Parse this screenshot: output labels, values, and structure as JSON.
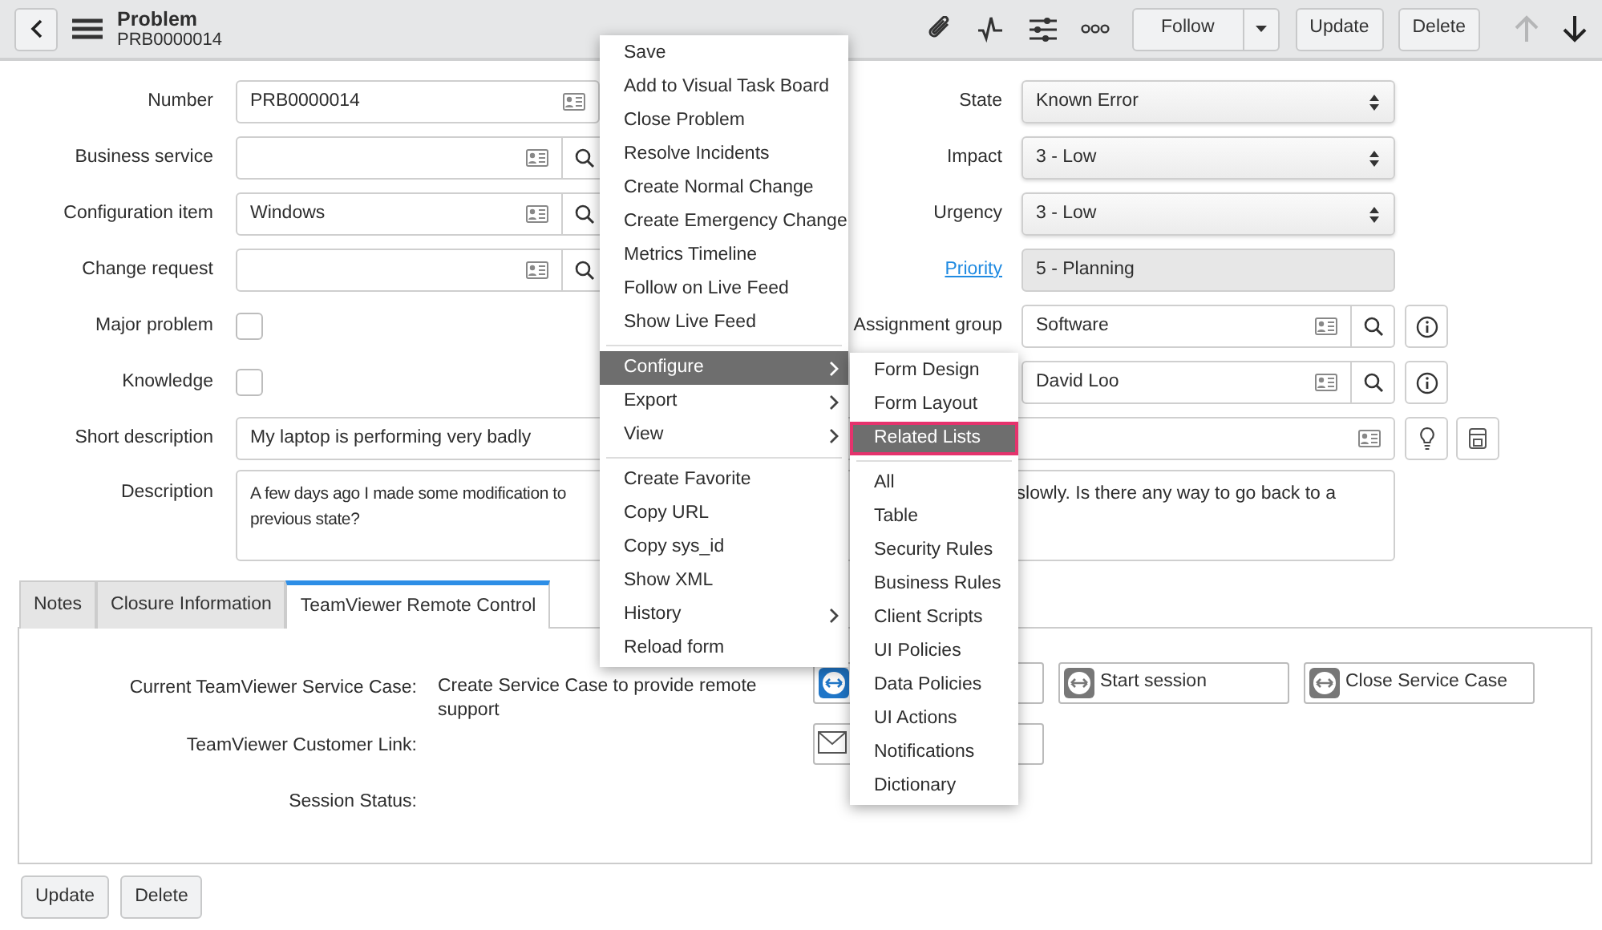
{
  "header": {
    "title": "Problem",
    "subtitle": "PRB0000014",
    "follow": "Follow",
    "buttons": [
      "Update",
      "Delete"
    ],
    "nav": [
      {
        "kind": "up",
        "disabled": true
      },
      {
        "kind": "down",
        "disabled": false
      }
    ]
  },
  "form": {
    "left": [
      {
        "label": "Number",
        "kind": "text-ref",
        "value": "PRB0000014"
      },
      {
        "label": "Business service",
        "kind": "reference"
      },
      {
        "label": "Configuration item",
        "kind": "reference",
        "value": "Windows"
      },
      {
        "label": "Change request",
        "kind": "reference"
      },
      {
        "label": "Major problem",
        "kind": "checkbox",
        "checked": false
      },
      {
        "label": "Knowledge",
        "kind": "checkbox",
        "checked": false
      }
    ],
    "right": [
      {
        "label": "State",
        "kind": "select",
        "value": "Known Error"
      },
      {
        "label": "Impact",
        "kind": "select",
        "value": "3 - Low"
      },
      {
        "label": "Urgency",
        "kind": "select",
        "value": "3 - Low"
      },
      {
        "label": "Priority",
        "kind": "readonly",
        "link": true,
        "value": "5 - Planning"
      },
      {
        "label": "Assignment group",
        "kind": "reference-info",
        "value": "Software"
      },
      {
        "kind": "reference-info",
        "value": "David Loo"
      }
    ],
    "short_description": {
      "label": "Short description",
      "value": "My laptop is performing very badly"
    },
    "description": {
      "label": "Description",
      "visible_left": "A few days ago I made some modification to",
      "visible_right": "slowly. Is there any way to go back to a",
      "line_2": "previous state?"
    }
  },
  "tabs": [
    {
      "label": "Notes",
      "selected": false
    },
    {
      "label": "Closure Information",
      "selected": false
    },
    {
      "label": "TeamViewer Remote Control",
      "selected": true
    }
  ],
  "teamviewer": {
    "rows": [
      {
        "label": "Current TeamViewer Service Case:",
        "value": "Create Service Case to provide remote support"
      },
      {
        "label": "TeamViewer Customer Link:"
      },
      {
        "label": "Session Status:"
      }
    ],
    "buttons": [
      {
        "kind": "teamviewer"
      },
      {
        "kind": "teamviewer",
        "label": "Start session"
      },
      {
        "kind": "teamviewer",
        "label": "Close Service Case"
      },
      {
        "kind": "mail"
      }
    ]
  },
  "footer_buttons": [
    "Update",
    "Delete"
  ],
  "context_menu": {
    "groups": [
      [
        {
          "label": "Save",
          "submenu": false,
          "selected": false
        },
        {
          "label": "Add to Visual Task Board",
          "submenu": false,
          "selected": false
        },
        {
          "label": "Close Problem",
          "submenu": false,
          "selected": false
        },
        {
          "label": "Resolve Incidents",
          "submenu": false,
          "selected": false
        },
        {
          "label": "Create Normal Change",
          "submenu": false,
          "selected": false
        },
        {
          "label": "Create Emergency Change",
          "submenu": false,
          "selected": false
        },
        {
          "label": "Metrics Timeline",
          "submenu": false,
          "selected": false
        },
        {
          "label": "Follow on Live Feed",
          "submenu": false,
          "selected": false
        },
        {
          "label": "Show Live Feed",
          "submenu": false,
          "selected": false
        }
      ],
      [
        {
          "label": "Configure",
          "submenu": true,
          "selected": true
        },
        {
          "label": "Export",
          "submenu": true,
          "selected": false
        },
        {
          "label": "View",
          "submenu": true,
          "selected": false
        }
      ],
      [
        {
          "label": "Create Favorite",
          "submenu": false,
          "selected": false
        },
        {
          "label": "Copy URL",
          "submenu": false,
          "selected": false
        },
        {
          "label": "Copy sys_id",
          "submenu": false,
          "selected": false
        },
        {
          "label": "Show XML",
          "submenu": false,
          "selected": false
        },
        {
          "label": "History",
          "submenu": true,
          "selected": false
        },
        {
          "label": "Reload form",
          "submenu": false,
          "selected": false
        }
      ]
    ]
  },
  "submenu": {
    "groups": [
      [
        {
          "label": "Form Design",
          "selected": false
        },
        {
          "label": "Form Layout",
          "selected": false
        },
        {
          "label": "Related Lists",
          "selected": true
        }
      ],
      [
        {
          "label": "All",
          "selected": false
        },
        {
          "label": "Table",
          "selected": false
        },
        {
          "label": "Security Rules",
          "selected": false
        },
        {
          "label": "Business Rules",
          "selected": false
        },
        {
          "label": "Client Scripts",
          "selected": false
        },
        {
          "label": "UI Policies",
          "selected": false
        },
        {
          "label": "Data Policies",
          "selected": false
        },
        {
          "label": "UI Actions",
          "selected": false
        },
        {
          "label": "Notifications",
          "selected": false
        },
        {
          "label": "Dictionary",
          "selected": false
        }
      ]
    ]
  }
}
